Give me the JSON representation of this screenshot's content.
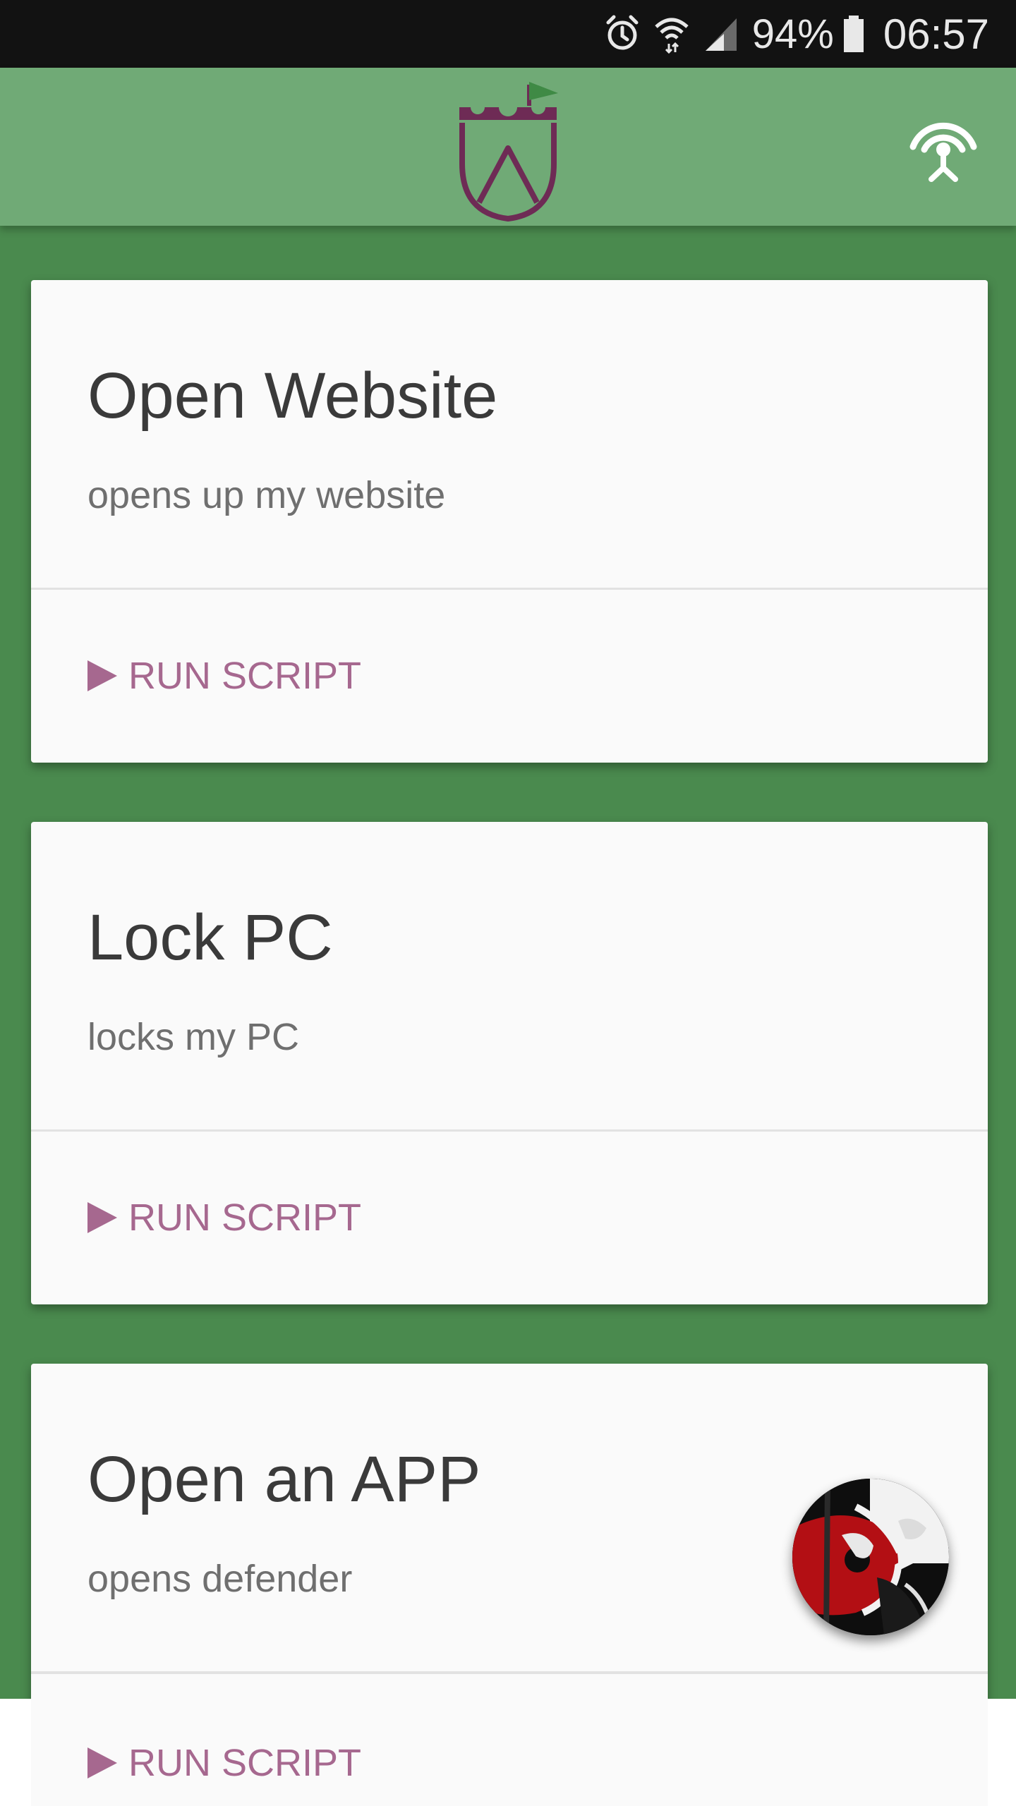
{
  "status_bar": {
    "battery_percent": "94%",
    "time": "06:57",
    "icons": [
      "alarm-icon",
      "wifi-icon",
      "signal-icon",
      "battery-icon"
    ]
  },
  "app_bar": {
    "logo": "castle-shield-logo",
    "action_icon": "broadcast-icon"
  },
  "colors": {
    "app_bar": "#70aa76",
    "background": "#4a8a4e",
    "accent": "#a6688f",
    "logo": "#6e2b55",
    "flag": "#3f8a45"
  },
  "scripts": [
    {
      "title": "Open Website",
      "description": "opens up my website",
      "action_label": "RUN SCRIPT"
    },
    {
      "title": "Lock PC",
      "description": "locks my PC",
      "action_label": "RUN SCRIPT"
    },
    {
      "title": "Open an APP",
      "description": "opens defender",
      "action_label": "RUN SCRIPT"
    }
  ],
  "fab": {
    "icon": "guitar-avatar-image"
  }
}
